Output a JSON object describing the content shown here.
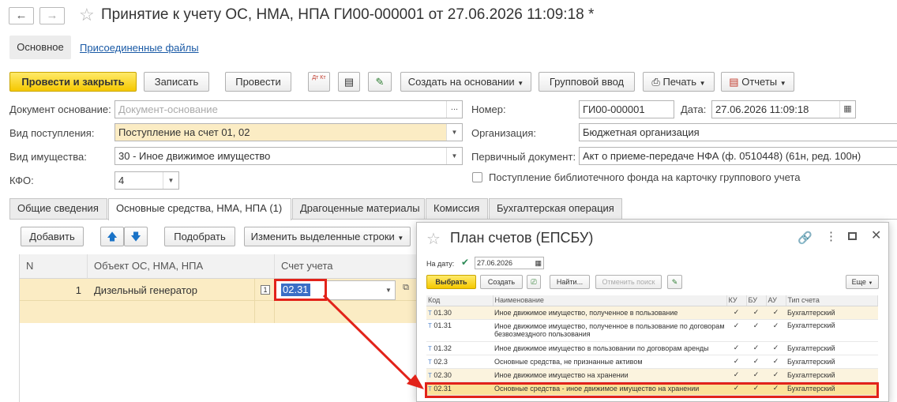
{
  "window": {
    "title": "Принятие к учету ОС, НМА, НПА ГИ00-000001 от 27.06.2026 11:09:18 *"
  },
  "sections": {
    "main": "Основное",
    "files": "Присоединенные файлы"
  },
  "toolbar": {
    "post_close": "Провести и закрыть",
    "write": "Записать",
    "post": "Провести",
    "dt_kt": "Дт Кт",
    "create_based": "Создать на основании",
    "group_input": "Групповой ввод",
    "print": "Печать",
    "reports": "Отчеты"
  },
  "form": {
    "doc_basis_label": "Документ основание:",
    "doc_basis_placeholder": "Документ-основание",
    "receipt_type_label": "Вид поступления:",
    "receipt_type_value": "Поступление на счет 01, 02",
    "property_type_label": "Вид имущества:",
    "property_type_value": "30 - Иное движимое имущество",
    "kfo_label": "КФО:",
    "kfo_value": "4",
    "number_label": "Номер:",
    "number_value": "ГИ00-000001",
    "date_label": "Дата:",
    "date_value": "27.06.2026 11:09:18",
    "org_label": "Организация:",
    "org_value": "Бюджетная организация",
    "primary_doc_label": "Первичный документ:",
    "primary_doc_value": "Акт о приеме-передаче НФА (ф. 0510448) (61н, ред. 100н)",
    "library_checkbox_label": "Поступление библиотечного фонда на карточку группового учета"
  },
  "tabs": [
    "Общие сведения",
    "Основные средства, НМА, НПА (1)",
    "Драгоценные материалы",
    "Комиссия",
    "Бухгалтерская операция"
  ],
  "table_toolbar": {
    "add": "Добавить",
    "pick": "Подобрать",
    "change_rows": "Изменить выделенные строки"
  },
  "assets_table": {
    "columns": [
      "N",
      "Объект ОС, НМА, НПА",
      "Счет учета"
    ],
    "rows": [
      {
        "n": "1",
        "object": "Дизельный генератор",
        "qty": "1",
        "account": "02.31"
      }
    ]
  },
  "dialog": {
    "title": "План счетов (ЕПСБУ)",
    "date_label": "На дату:",
    "date_value": "27.06.2026",
    "select": "Выбрать",
    "create": "Создать",
    "find": "Найти...",
    "cancel_search": "Отменить поиск",
    "more": "Еще",
    "columns": [
      "Код",
      "Наименование",
      "КУ",
      "БУ",
      "АУ",
      "Тип счета"
    ],
    "rows": [
      {
        "code": "01.30",
        "name": "Иное движимое имущество, полученное в пользование",
        "ku": "✓",
        "bu": "✓",
        "au": "✓",
        "type": "Бухгалтерский"
      },
      {
        "code": "01.31",
        "name": "Иное движимое имущество, полученное в пользование по договорам безвозмездного пользования",
        "ku": "✓",
        "bu": "✓",
        "au": "✓",
        "type": "Бухгалтерский"
      },
      {
        "code": "01.32",
        "name": "Иное движимое имущество в пользовании по договорам аренды",
        "ku": "✓",
        "bu": "✓",
        "au": "✓",
        "type": "Бухгалтерский"
      },
      {
        "code": "02.3",
        "name": "Основные средства, не признанные активом",
        "ku": "✓",
        "bu": "✓",
        "au": "✓",
        "type": "Бухгалтерский"
      },
      {
        "code": "02.30",
        "name": "Иное движимое имущество на хранении",
        "ku": "✓",
        "bu": "✓",
        "au": "✓",
        "type": "Бухгалтерский"
      },
      {
        "code": "02.31",
        "name": "Основные средства - иное движимое имущество на хранении",
        "ku": "✓",
        "bu": "✓",
        "au": "✓",
        "type": "Бухгалтерский"
      }
    ]
  },
  "colors": {
    "primary_button": "#f5c800",
    "highlight_field": "#fbecc4",
    "annotation_red": "#e2231a",
    "link_blue": "#1a5aa6"
  }
}
